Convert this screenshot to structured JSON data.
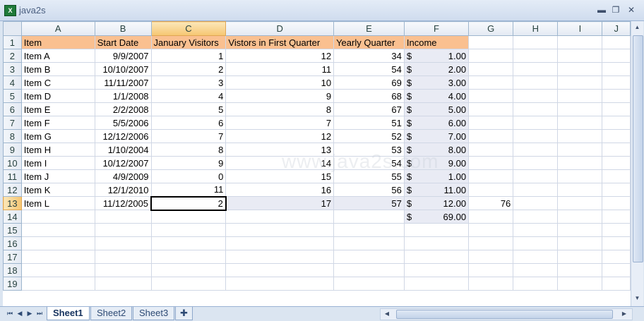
{
  "window": {
    "title": "java2s",
    "app_icon": "excel-icon"
  },
  "columns": [
    "A",
    "B",
    "C",
    "D",
    "E",
    "F",
    "G",
    "H",
    "I",
    "J"
  ],
  "selected_column": "C",
  "rows": [
    {
      "n": "1",
      "a": "Item",
      "b": "Start Date",
      "c": "January Visitors",
      "d": "Vistors in First Quarter",
      "e": "Yearly Quarter",
      "f": "Income",
      "g": ""
    },
    {
      "n": "2",
      "a": "Item A",
      "b": "9/9/2007",
      "c": "1",
      "d": "12",
      "e": "34",
      "f_cur": "$",
      "f": "1.00",
      "g": ""
    },
    {
      "n": "3",
      "a": "Item B",
      "b": "10/10/2007",
      "c": "2",
      "d": "11",
      "e": "54",
      "f_cur": "$",
      "f": "2.00",
      "g": ""
    },
    {
      "n": "4",
      "a": "Item C",
      "b": "11/11/2007",
      "c": "3",
      "d": "10",
      "e": "69",
      "f_cur": "$",
      "f": "3.00",
      "g": ""
    },
    {
      "n": "5",
      "a": "Item D",
      "b": "1/1/2008",
      "c": "4",
      "d": "9",
      "e": "68",
      "f_cur": "$",
      "f": "4.00",
      "g": ""
    },
    {
      "n": "6",
      "a": "Item E",
      "b": "2/2/2008",
      "c": "5",
      "d": "8",
      "e": "67",
      "f_cur": "$",
      "f": "5.00",
      "g": ""
    },
    {
      "n": "7",
      "a": "Item F",
      "b": "5/5/2006",
      "c": "6",
      "d": "7",
      "e": "51",
      "f_cur": "$",
      "f": "6.00",
      "g": ""
    },
    {
      "n": "8",
      "a": "Item G",
      "b": "12/12/2006",
      "c": "7",
      "d": "12",
      "e": "52",
      "f_cur": "$",
      "f": "7.00",
      "g": ""
    },
    {
      "n": "9",
      "a": "Item H",
      "b": "1/10/2004",
      "c": "8",
      "d": "13",
      "e": "53",
      "f_cur": "$",
      "f": "8.00",
      "g": ""
    },
    {
      "n": "10",
      "a": "Item I",
      "b": "10/12/2007",
      "c": "9",
      "d": "14",
      "e": "54",
      "f_cur": "$",
      "f": "9.00",
      "g": ""
    },
    {
      "n": "11",
      "a": "Item J",
      "b": "4/9/2009",
      "c": "0",
      "d": "15",
      "e": "55",
      "f_cur": "$",
      "f": "1.00",
      "g": ""
    },
    {
      "n": "12",
      "a": "Item K",
      "b": "12/1/2010",
      "c": "11",
      "d": "16",
      "e": "56",
      "f_cur": "$",
      "f": "11.00",
      "g": ""
    },
    {
      "n": "13",
      "a": "Item L",
      "b": "11/12/2005",
      "c": "2",
      "d": "17",
      "e": "57",
      "f_cur": "$",
      "f": "12.00",
      "g": "76"
    },
    {
      "n": "14",
      "a": "",
      "b": "",
      "c": "",
      "d": "",
      "e": "",
      "f_cur": "$",
      "f": "69.00",
      "g": ""
    },
    {
      "n": "15",
      "a": "",
      "b": "",
      "c": "",
      "d": "",
      "e": "",
      "f": "",
      "g": ""
    },
    {
      "n": "16",
      "a": "",
      "b": "",
      "c": "",
      "d": "",
      "e": "",
      "f": "",
      "g": ""
    },
    {
      "n": "17",
      "a": "",
      "b": "",
      "c": "",
      "d": "",
      "e": "",
      "f": "",
      "g": ""
    },
    {
      "n": "18",
      "a": "",
      "b": "",
      "c": "",
      "d": "",
      "e": "",
      "f": "",
      "g": ""
    },
    {
      "n": "19",
      "a": "",
      "b": "",
      "c": "",
      "d": "",
      "e": "",
      "f": "",
      "g": ""
    }
  ],
  "active_cell": "C13",
  "sheets": [
    "Sheet1",
    "Sheet2",
    "Sheet3"
  ],
  "active_sheet": "Sheet1",
  "watermark": "www.java2s.com",
  "colors": {
    "header_fill": "#fac090",
    "income_fill": "#e9ebf4",
    "selected_header": "#f6c671"
  }
}
